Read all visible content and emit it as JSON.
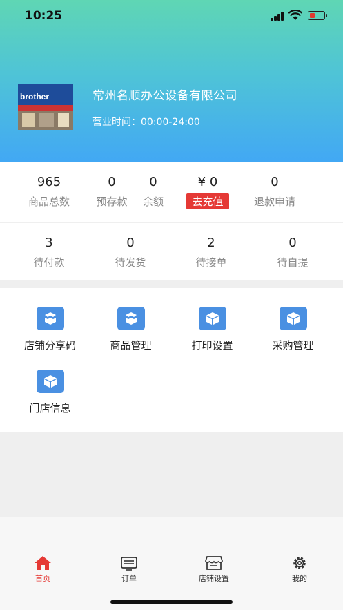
{
  "status_bar": {
    "time": "10:25"
  },
  "store": {
    "name": "常州名顺办公设备有限公司",
    "hours": "营业时间：00:00-24:00",
    "photo_sign": "brother"
  },
  "stats_top": [
    {
      "value": "965",
      "label": "商品总数"
    },
    {
      "value": "0",
      "label": "预存款"
    },
    {
      "value": "0",
      "label": "余额"
    },
    {
      "value": "¥ 0",
      "label": "",
      "action": "去充值"
    },
    {
      "value": "0",
      "label": "退款申请"
    }
  ],
  "stats_orders": [
    {
      "value": "3",
      "label": "待付款"
    },
    {
      "value": "0",
      "label": "待发货"
    },
    {
      "value": "2",
      "label": "待接单"
    },
    {
      "value": "0",
      "label": "待自提"
    }
  ],
  "menu": [
    {
      "label": "店铺分享码",
      "icon": "box-open-icon"
    },
    {
      "label": "商品管理",
      "icon": "box-open-icon"
    },
    {
      "label": "打印设置",
      "icon": "box-icon"
    },
    {
      "label": "采购管理",
      "icon": "box-icon"
    },
    {
      "label": "门店信息",
      "icon": "box-icon"
    }
  ],
  "tabs": [
    {
      "label": "首页",
      "icon": "home-icon",
      "active": true
    },
    {
      "label": "订单",
      "icon": "keyboard-icon",
      "active": false
    },
    {
      "label": "店铺设置",
      "icon": "store-icon",
      "active": false
    },
    {
      "label": "我的",
      "icon": "gear-icon",
      "active": false
    }
  ],
  "colors": {
    "accent": "#e53935",
    "icon_blue": "#4a90e2",
    "header_top": "#5fd6b4",
    "header_bottom": "#42a8f4"
  }
}
